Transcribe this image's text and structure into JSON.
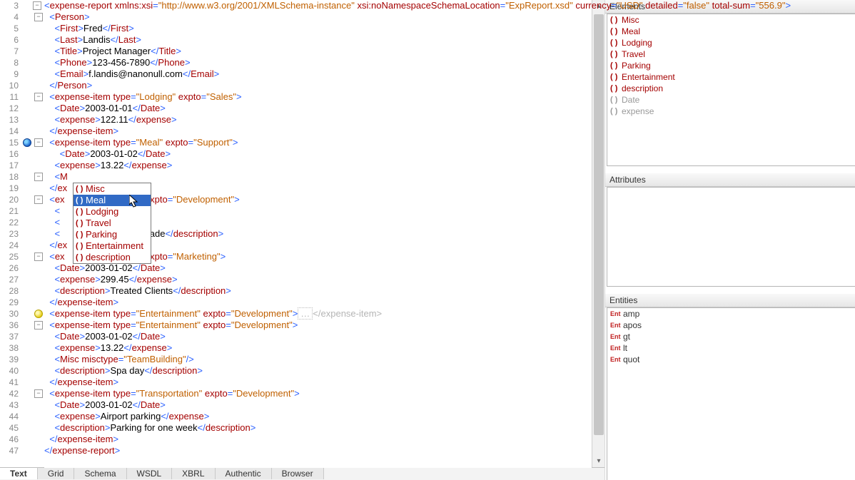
{
  "line_start": 3,
  "lines": {
    "3": "<expense-report xmlns:xsi=\"http://www.w3.org/2001/XMLSchema-instance\" xsi:noNamespaceSchemaLocation=\"ExpReport.xsd\" currency=\"USD\" detailed=\"false\" total-sum=\"556.9\">",
    "4": "  <Person>",
    "5": "    <First>Fred</First>",
    "6": "    <Last>Landis</Last>",
    "7": "    <Title>Project Manager</Title>",
    "8": "    <Phone>123-456-7890</Phone>",
    "9": "    <Email>f.landis@nanonull.com</Email>",
    "10": "  </Person>",
    "11": "  <expense-item type=\"Lodging\" expto=\"Sales\">",
    "12": "    <Date>2003-01-01</Date>",
    "13": "    <expense>122.11</expense>",
    "14": "  </expense-item>",
    "15": "  <expense-item type=\"Meal\" expto=\"Support\">",
    "16": "      <Date>2003-01-02</Date>",
    "17": "    <expense>13.22</expense>",
    "18": "    <M",
    "19": "  </expense-item>",
    "20": "  <expense-item type=\"Lodging\" expto=\"Development\">",
    "21": "    <Date>2003-01-02</Date>",
    "22": "    <expense>299.45</expense>",
    "23": "    <description>Played penny arcade</description>",
    "24": "  </expense-item>",
    "25": "  <expense-item type=\"Lodging\" expto=\"Marketing\">",
    "26": "    <Date>2003-01-02</Date>",
    "27": "    <expense>299.45</expense>",
    "28": "    <description>Treated Clients</description>",
    "29": "  </expense-item>",
    "30": "  <expense-item type=\"Entertainment\" expto=\"Development\">…</expense-item>",
    "36": "  <expense-item type=\"Entertainment\" expto=\"Development\">",
    "37": "    <Date>2003-01-02</Date>",
    "38": "    <expense>13.22</expense>",
    "39": "    <Misc misctype=\"TeamBuilding\"/>",
    "40": "    <description>Spa day</description>",
    "41": "  </expense-item>",
    "42": "  <expense-item type=\"Transportation\" expto=\"Development\">",
    "43": "    <Date>2003-01-02</Date>",
    "44": "    <expense>Airport parking</expense>",
    "45": "    <description>Parking for one week</description>",
    "46": "  </expense-item>",
    "47": "</expense-report>"
  },
  "folded_caret_close": "</expense-item>",
  "autocomplete": {
    "items": [
      "Misc",
      "Meal",
      "Lodging",
      "Travel",
      "Parking",
      "Entertainment",
      "description"
    ],
    "selected_index": 1
  },
  "tabs": [
    "Text",
    "Grid",
    "Schema",
    "WSDL",
    "XBRL",
    "Authentic",
    "Browser"
  ],
  "active_tab": 0,
  "panels": {
    "elements": {
      "title": "Elements",
      "items": [
        {
          "name": "Misc",
          "kind": "elem"
        },
        {
          "name": "Meal",
          "kind": "elem"
        },
        {
          "name": "Lodging",
          "kind": "elem"
        },
        {
          "name": "Travel",
          "kind": "elem"
        },
        {
          "name": "Parking",
          "kind": "elem"
        },
        {
          "name": "Entertainment",
          "kind": "elem"
        },
        {
          "name": "description",
          "kind": "elem"
        },
        {
          "name": "Date",
          "kind": "gray"
        },
        {
          "name": "expense",
          "kind": "gray"
        }
      ]
    },
    "attributes": {
      "title": "Attributes"
    },
    "entities": {
      "title": "Entities",
      "items": [
        "amp",
        "apos",
        "gt",
        "lt",
        "quot"
      ]
    }
  }
}
